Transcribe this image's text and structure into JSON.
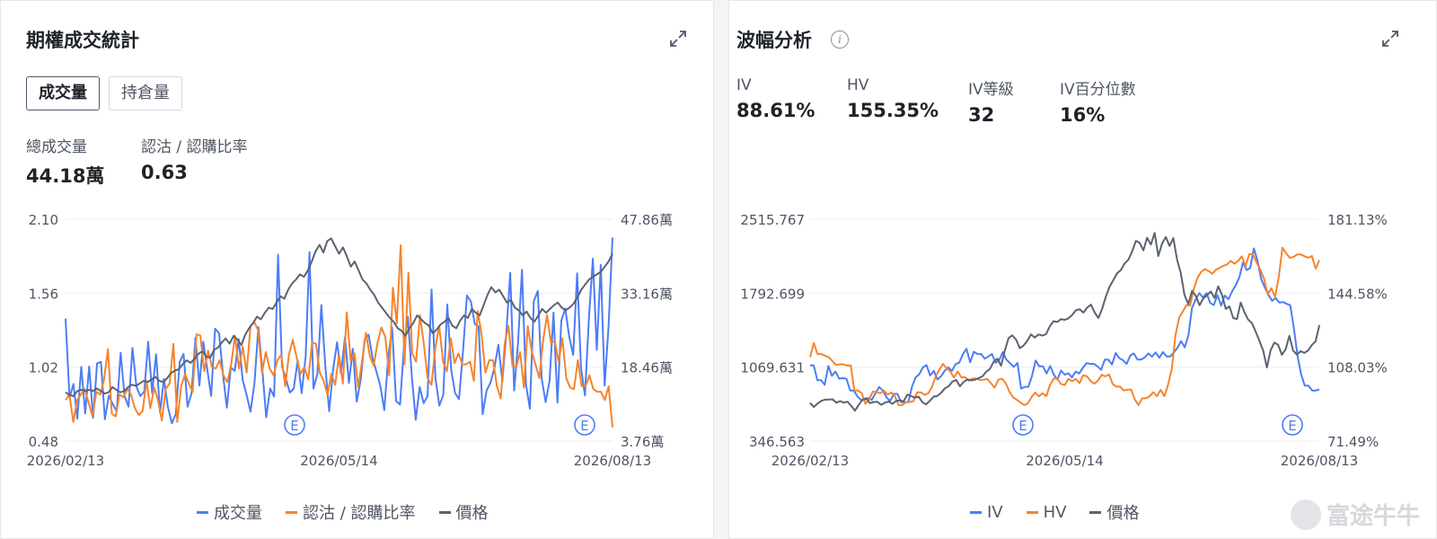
{
  "left_panel": {
    "title": "期權成交統計",
    "tabs": [
      {
        "label": "成交量",
        "active": true
      },
      {
        "label": "持倉量",
        "active": false
      }
    ],
    "stats": [
      {
        "label": "總成交量",
        "value": "44.18萬"
      },
      {
        "label": "認沽 / 認購比率",
        "value": "0.63"
      }
    ],
    "legend": [
      {
        "label": "成交量",
        "color": "#4d7cf5"
      },
      {
        "label": "認沽 / 認購比率",
        "color": "#f5842c"
      },
      {
        "label": "價格",
        "color": "#5b6270"
      }
    ]
  },
  "right_panel": {
    "title": "波幅分析",
    "stats": [
      {
        "label": "IV",
        "value": "88.61%"
      },
      {
        "label": "HV",
        "value": "155.35%"
      },
      {
        "label": "IV等級",
        "value": "32"
      },
      {
        "label": "IV百分位數",
        "value": "16%"
      }
    ],
    "legend": [
      {
        "label": "IV",
        "color": "#4d7cf5"
      },
      {
        "label": "HV",
        "color": "#f5842c"
      },
      {
        "label": "價格",
        "color": "#5b6270"
      }
    ]
  },
  "watermark": "富途牛牛",
  "chart_data": [
    {
      "type": "line",
      "title": "期權成交統計",
      "x_ticks": [
        "2026/02/13",
        "2026/05/14",
        "2026/08/13"
      ],
      "earnings_marker": "E",
      "y_left_ticks": [
        "2.10",
        "1.56",
        "1.02",
        "0.48"
      ],
      "y_left_range": [
        0.48,
        2.1
      ],
      "y_right_ticks": [
        "47.86萬",
        "33.16萬",
        "18.46萬",
        "3.76萬"
      ],
      "y_right_range_wan": [
        3.76,
        47.86
      ],
      "series": [
        {
          "name": "成交量",
          "axis": "right",
          "unit": "萬",
          "color": "#4d7cf5",
          "values": [
            28.1,
            12.4,
            15.1,
            8.2,
            18.5,
            9.3,
            18.6,
            8.4,
            19.2,
            19.5,
            8.1,
            12.8,
            11.1,
            9.7,
            21.3,
            12.7,
            10.6,
            22.3,
            14.6,
            12.7,
            13.6,
            23.5,
            13.3,
            21.0,
            9.4,
            16.1,
            10.6,
            7.3,
            9.1,
            19.5,
            21.1,
            10.6,
            13.2,
            24.3,
            14.8,
            23.5,
            18.1,
            12.7,
            26.1,
            25.2,
            17.0,
            10.4,
            18.4,
            17.7,
            24.0,
            15.9,
            13.0,
            9.6,
            15.2,
            26.4,
            17.9,
            8.5,
            14.2,
            12.6,
            40.8,
            18.6,
            16.1,
            13.4,
            14.2,
            19.8,
            13.3,
            20.5,
            41.3,
            14.2,
            17.1,
            30.8,
            18.7,
            9.7,
            18.0,
            23.4,
            17.2,
            24.4,
            15.3,
            22.1,
            11.6,
            15.9,
            23.9,
            24.9,
            20.4,
            17.6,
            14.7,
            9.9,
            20.5,
            26.3,
            11.7,
            11.0,
            22.5,
            28.4,
            16.5,
            8.0,
            14.5,
            11.3,
            12.7,
            33.9,
            16.3,
            10.8,
            13.0,
            30.9,
            17.9,
            13.3,
            12.1,
            21.5,
            32.7,
            31.5,
            27.0,
            26.5,
            9.1,
            13.8,
            15.4,
            18.4,
            22.9,
            15.6,
            25.1,
            37.2,
            13.8,
            23.3,
            37.8,
            15.0,
            10.2,
            31.6,
            33.6,
            16.2,
            11.5,
            15.7,
            29.3,
            11.4,
            27.7,
            30.1,
            24.5,
            20.9,
            37.1,
            18.4,
            12.8,
            28.1,
            40.0,
            21.9,
            38.8,
            14.8,
            26.6,
            44.2
          ]
        },
        {
          "name": "認沽 / 認購比率",
          "axis": "left",
          "color": "#f5842c",
          "values": [
            0.78,
            0.82,
            0.62,
            0.78,
            0.82,
            0.86,
            0.76,
            0.66,
            0.84,
            0.82,
            0.93,
            1.15,
            0.68,
            0.66,
            0.82,
            0.8,
            0.86,
            0.82,
            0.72,
            0.67,
            0.7,
            0.92,
            0.72,
            0.87,
            0.78,
            0.63,
            0.86,
            0.9,
            1.19,
            0.62,
            0.88,
            0.97,
            0.9,
            0.84,
            1.26,
            1.25,
            0.99,
            1.14,
            1.02,
            1.01,
            1.07,
            0.96,
            0.91,
            1.04,
            1.25,
            1.01,
            1.17,
            0.98,
            1.32,
            1.35,
            1.29,
            0.98,
            1.13,
            1.01,
            0.96,
            1.07,
            1.11,
            0.88,
            1.11,
            1.22,
            1.09,
            0.97,
            1.02,
            0.93,
            1.2,
            1.19,
            0.98,
            0.92,
            0.82,
            0.97,
            0.89,
            1.11,
            0.9,
            1.42,
            1.07,
            1.12,
            0.87,
            1.07,
            1.27,
            1.1,
            1.03,
            1.2,
            1.31,
            1.24,
            0.96,
            1.6,
            1.34,
            1.91,
            1.04,
            1.71,
            1.12,
            1.06,
            1.4,
            1.19,
            0.94,
            0.89,
            1.16,
            1.32,
            1.06,
            0.99,
            1.23,
            1.05,
            1.12,
            1.04,
            1.04,
            1.06,
            0.92,
            1.43,
            1.26,
            0.98,
            1.07,
            1.07,
            0.88,
            0.79,
            1.19,
            1.32,
            1.03,
            1.02,
            1.13,
            0.87,
            1.32,
            1.14,
            1.04,
            0.94,
            1.22,
            1.4,
            1.2,
            1.21,
            1.06,
            1.23,
            0.94,
            0.87,
            0.86,
            1.07,
            0.88,
            0.88,
            0.96,
            0.86,
            0.84,
            0.84,
            0.78,
            0.88,
            0.58
          ]
        },
        {
          "name": "價格",
          "axis": "none",
          "color": "#5b6270",
          "values": [
            0.7,
            0.68,
            0.67,
            0.71,
            0.72,
            0.71,
            0.72,
            0.71,
            0.73,
            0.71,
            0.69,
            0.7,
            0.74,
            0.72,
            0.7,
            0.71,
            0.74,
            0.76,
            0.75,
            0.77,
            0.79,
            0.78,
            0.8,
            0.82,
            0.79,
            0.78,
            0.81,
            0.85,
            0.87,
            0.88,
            0.92,
            0.95,
            0.93,
            0.96,
            1.0,
            1.02,
            0.98,
            0.97,
            1.03,
            1.05,
            1.09,
            1.12,
            1.08,
            1.14,
            1.11,
            1.07,
            1.15,
            1.2,
            1.24,
            1.29,
            1.27,
            1.32,
            1.36,
            1.35,
            1.4,
            1.45,
            1.43,
            1.5,
            1.55,
            1.58,
            1.62,
            1.6,
            1.65,
            1.72,
            1.8,
            1.85,
            1.79,
            1.88,
            1.9,
            1.84,
            1.78,
            1.83,
            1.76,
            1.68,
            1.72,
            1.65,
            1.58,
            1.55,
            1.5,
            1.46,
            1.4,
            1.36,
            1.32,
            1.28,
            1.25,
            1.2,
            1.18,
            1.14,
            1.2,
            1.24,
            1.3,
            1.27,
            1.24,
            1.22,
            1.16,
            1.19,
            1.23,
            1.25,
            1.28,
            1.22,
            1.2,
            1.26,
            1.3,
            1.28,
            1.35,
            1.32,
            1.3,
            1.38,
            1.46,
            1.52,
            1.48,
            1.5,
            1.45,
            1.4,
            1.42,
            1.36,
            1.34,
            1.3,
            1.33,
            1.28,
            1.25,
            1.3,
            1.35,
            1.32,
            1.35,
            1.38,
            1.4,
            1.36,
            1.34,
            1.36,
            1.39,
            1.44,
            1.5,
            1.54,
            1.58,
            1.6,
            1.62,
            1.64,
            1.68,
            1.72,
            1.78
          ]
        }
      ]
    },
    {
      "type": "line",
      "title": "波幅分析",
      "x_ticks": [
        "2026/02/13",
        "2026/05/14",
        "2026/08/13"
      ],
      "earnings_marker": "E",
      "y_left_ticks": [
        "2515.767",
        "1792.699",
        "1069.631",
        "346.563"
      ],
      "y_left_range": [
        346.563,
        2515.767
      ],
      "y_right_ticks": [
        "181.13%",
        "144.58%",
        "108.03%",
        "71.49%"
      ],
      "y_right_range": [
        71.49,
        181.13
      ],
      "series": [
        {
          "name": "IV",
          "axis": "right",
          "unit": "%",
          "color": "#4d7cf5",
          "values": [
            108.9,
            108.9,
            101.6,
            101.6,
            99.3,
            108.6,
            103.7,
            105.8,
            102.3,
            102.6,
            102.3,
            96.5,
            96.5,
            93.6,
            91.8,
            91.8,
            92.8,
            91.8,
            95.3,
            98.2,
            96.5,
            93.0,
            91.3,
            94.8,
            94.8,
            90.7,
            90.7,
            90.7,
            98.2,
            102.9,
            104.5,
            107.9,
            109.0,
            103.9,
            106.2,
            101.9,
            103.5,
            106.2,
            107.9,
            106.2,
            109.5,
            110.3,
            114.4,
            117.1,
            110.4,
            115.6,
            114.5,
            114.5,
            112.2,
            113.3,
            114.5,
            110.2,
            111.6,
            115.5,
            111.7,
            109.9,
            108.1,
            110.1,
            97.4,
            98.3,
            98.3,
            103.7,
            111.3,
            108.4,
            108.4,
            104.9,
            108.6,
            104.3,
            101.9,
            106.4,
            104.3,
            105.0,
            102.9,
            105.8,
            104.9,
            107.8,
            110.0,
            109.6,
            109.6,
            108.4,
            106.7,
            111.7,
            111.7,
            109.3,
            115.0,
            112.4,
            111.5,
            109.6,
            113.7,
            114.8,
            111.8,
            111.8,
            112.8,
            114.8,
            113.2,
            115.3,
            112.7,
            115.5,
            113.3,
            113.3,
            115.3,
            117.6,
            120.9,
            117.8,
            123.7,
            137.4,
            141.5,
            144.6,
            142.4,
            144.6,
            139.7,
            138.7,
            143.6,
            138.4,
            143.4,
            141.6,
            145.4,
            148.5,
            152.4,
            159.8,
            156.0,
            157.0,
            166.7,
            160.7,
            151.6,
            147.4,
            143.7,
            140.8,
            142.2,
            139.9,
            140.2,
            139.3,
            138.6,
            127.4,
            113.7,
            104.3,
            98.9,
            98.9,
            96.5,
            96.5,
            97.0
          ]
        },
        {
          "name": "HV",
          "axis": "right",
          "unit": "%",
          "color": "#f5842c",
          "values": [
            113.0,
            119.9,
            114.5,
            114.5,
            113.7,
            113.0,
            111.1,
            109.1,
            109.4,
            109.4,
            108.8,
            108.9,
            96.5,
            96.5,
            95.2,
            89.9,
            92.0,
            96.0,
            95.7,
            95.1,
            96.5,
            94.4,
            95.5,
            93.5,
            89.3,
            89.3,
            90.8,
            90.8,
            91.2,
            95.6,
            95.6,
            94.3,
            95.1,
            98.1,
            103.3,
            106.7,
            109.6,
            107.5,
            105.9,
            102.9,
            105.9,
            102.9,
            103.1,
            101.3,
            102.4,
            102.4,
            101.7,
            101.8,
            102.2,
            100.1,
            97.9,
            101.8,
            102.3,
            100.1,
            95.9,
            93.1,
            91.9,
            90.6,
            89.3,
            90.1,
            93.2,
            95.5,
            93.6,
            95.2,
            93.7,
            99.2,
            102.4,
            102.4,
            99.7,
            99.2,
            102.3,
            101.1,
            102.2,
            100.1,
            104.0,
            103.5,
            101.2,
            99.8,
            101.3,
            104.2,
            103.5,
            104.4,
            99.7,
            98.4,
            98.4,
            96.5,
            96.9,
            96.9,
            92.0,
            89.3,
            92.6,
            92.6,
            93.6,
            95.7,
            93.7,
            96.8,
            93.7,
            99.2,
            107.1,
            123.8,
            132.5,
            135.6,
            138.7,
            138.5,
            146.8,
            152.3,
            155.1,
            156.5,
            155.5,
            154.2,
            156.2,
            157.1,
            158.1,
            158.8,
            160.6,
            159.1,
            160.5,
            162.8,
            157.9,
            163.8,
            163.8,
            159.7,
            156.2,
            151.7,
            144.2,
            147.0,
            142.7,
            152.5,
            167.0,
            164.3,
            162.0,
            162.5,
            163.7,
            163.7,
            162.8,
            162.1,
            162.9,
            156.7,
            160.9
          ]
        },
        {
          "name": "價格",
          "axis": "left",
          "color": "#5b6270",
          "values": [
            719,
            680,
            714,
            740,
            751,
            752,
            755,
            722,
            737,
            723,
            731,
            689,
            644,
            701,
            752,
            764,
            717,
            729,
            730,
            701,
            723,
            733,
            710,
            740,
            744,
            736,
            802,
            786,
            772,
            780,
            725,
            706,
            741,
            782,
            787,
            819,
            862,
            882,
            928,
            945,
            882,
            924,
            949,
            940,
            946,
            962,
            979,
            1023,
            1052,
            1121,
            1153,
            1084,
            1232,
            1354,
            1380,
            1339,
            1255,
            1280,
            1327,
            1390,
            1359,
            1389,
            1378,
            1392,
            1467,
            1519,
            1510,
            1539,
            1531,
            1547,
            1580,
            1626,
            1636,
            1602,
            1652,
            1681,
            1602,
            1550,
            1640,
            1762,
            1856,
            1921,
            1988,
            2019,
            2083,
            2120,
            2200,
            2303,
            2286,
            2211,
            2335,
            2267,
            2381,
            2156,
            2279,
            2343,
            2254,
            2331,
            2121,
            1990,
            1773,
            1688,
            1816,
            1767,
            1675,
            1741,
            1772,
            1810,
            1746,
            1860,
            1776,
            1638,
            1664,
            1550,
            1539,
            1701,
            1606,
            1534,
            1499,
            1417,
            1327,
            1230,
            1067,
            1236,
            1310,
            1287,
            1190,
            1245,
            1375,
            1232,
            1191,
            1226,
            1208,
            1232,
            1285,
            1321,
            1480
          ]
        }
      ]
    }
  ]
}
